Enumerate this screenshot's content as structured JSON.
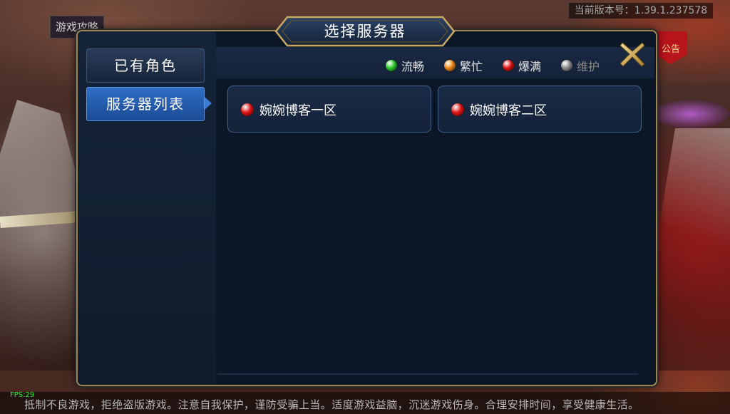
{
  "app": {
    "version_text": "当前版本号：1.39.1.237578",
    "guide_label": "游戏攻略",
    "notice_label": "公告",
    "fps": "FPS:29",
    "footer_notice": "抵制不良游戏，拒绝盗版游戏。注意自我保护，谨防受骗上当。适度游戏益脑，沉迷游戏伤身。合理安排时间，享受健康生活。"
  },
  "dialog": {
    "title": "选择服务器",
    "tabs": [
      {
        "label": "已有角色",
        "active": false
      },
      {
        "label": "服务器列表",
        "active": true
      }
    ],
    "legend": [
      {
        "label": "流畅",
        "color": "#2ecc2e"
      },
      {
        "label": "繁忙",
        "color": "#f08a14"
      },
      {
        "label": "爆满",
        "color": "#e01414"
      },
      {
        "label": "维护",
        "color": "#8e8e8e"
      }
    ],
    "servers": [
      {
        "name": "婉婉博客一区",
        "status": "爆满",
        "color": "#e01414"
      },
      {
        "name": "婉婉博客二区",
        "status": "爆满",
        "color": "#e01414"
      }
    ]
  }
}
